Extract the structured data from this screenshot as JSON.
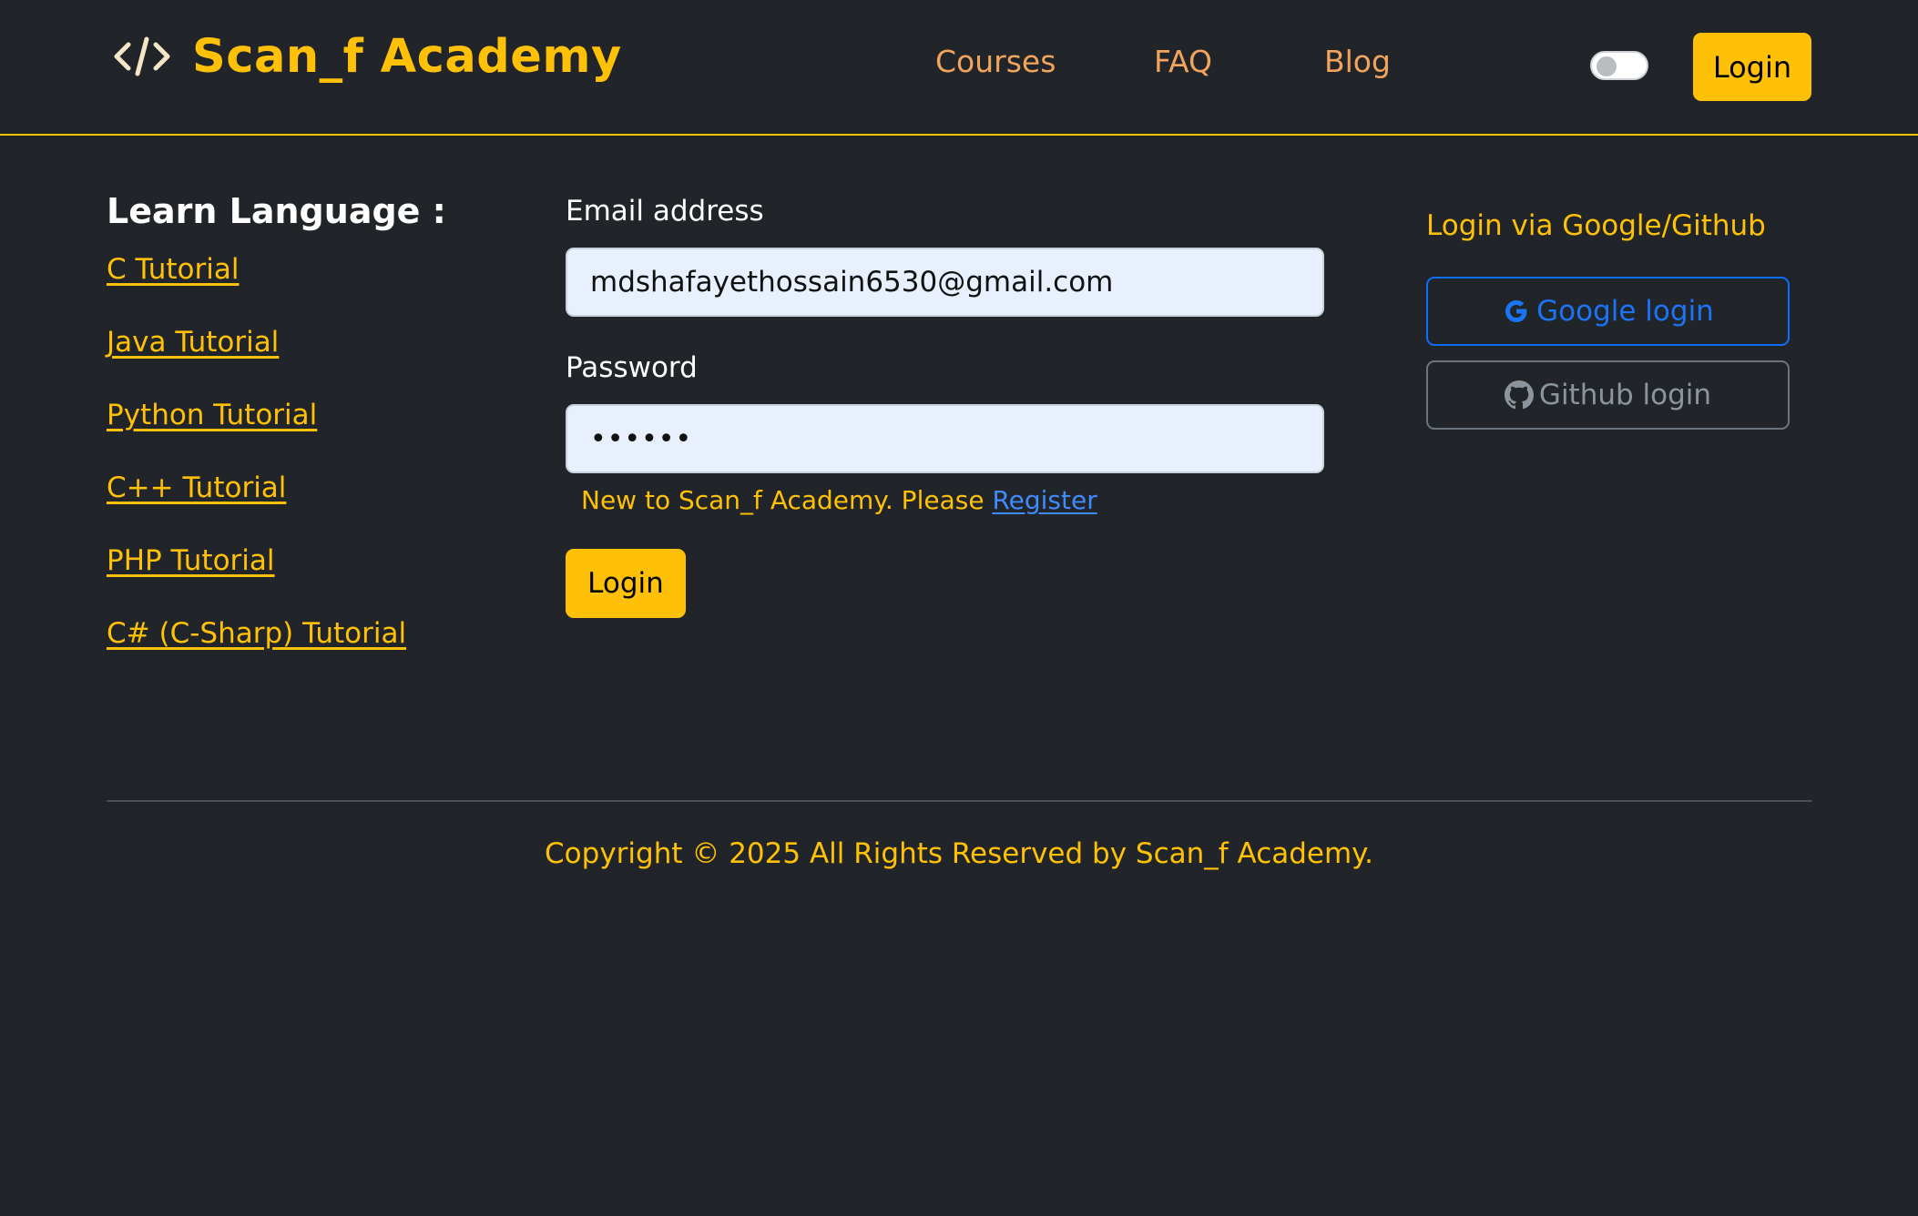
{
  "brand": {
    "name": "Scan_f Academy",
    "icon": "code-icon",
    "accent_color": "#ffc107"
  },
  "nav": {
    "links": [
      "Courses",
      "FAQ",
      "Blog"
    ],
    "theme_toggle": "theme-toggle",
    "login_label": "Login"
  },
  "sidebar": {
    "title": "Learn Language :",
    "links": [
      "C Tutorial",
      "Java Tutorial",
      "Python Tutorial",
      "C++ Tutorial",
      "PHP Tutorial",
      "C# (C-Sharp) Tutorial"
    ]
  },
  "form": {
    "email_label": "Email address",
    "email_value": "mdshafayethossain6530@gmail.com",
    "password_label": "Password",
    "password_value": "••••••",
    "register_prompt": "New to Scan_f Academy. Please",
    "register_link": "Register",
    "submit_label": "Login"
  },
  "social": {
    "title": "Login via Google/Github",
    "google_label": "Google login",
    "github_label": "Github login",
    "google_icon": "google-icon",
    "github_icon": "github-icon"
  },
  "footer": {
    "copyright": "Copyright © 2025 All Rights Reserved by Scan_f Academy."
  },
  "colors": {
    "background": "#212529",
    "accent": "#ffc107",
    "nav_link": "#f2a45c",
    "google_blue": "#0d6efd",
    "github_gray": "#6c757d",
    "input_bg": "#e8f0fe"
  }
}
